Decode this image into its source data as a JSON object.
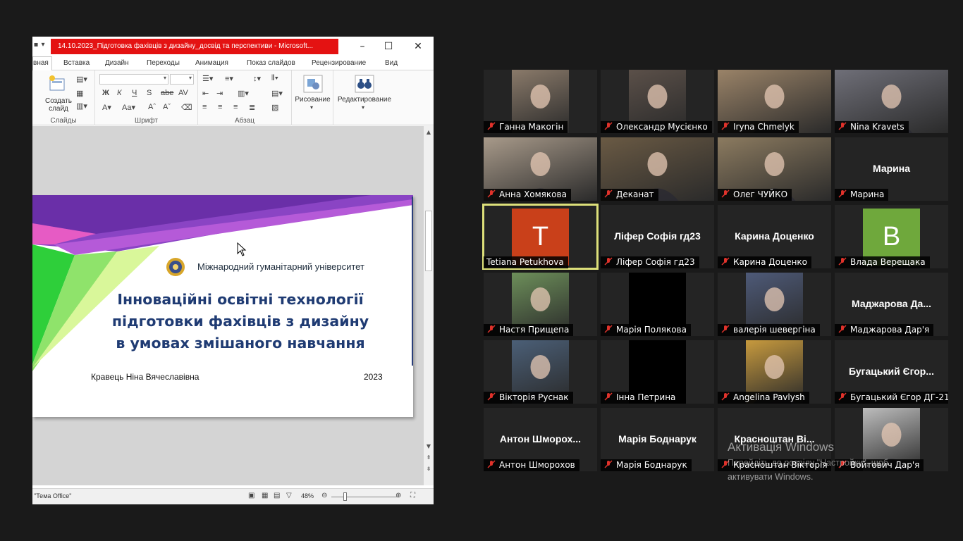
{
  "ppt": {
    "title": "14.10.2023_Підготовка фахівців з дизайну_досвід та перспективи  -  Microsoft...",
    "tabs": [
      "вная",
      "Вставка",
      "Дизайн",
      "Переходы",
      "Анимация",
      "Показ слайдов",
      "Рецензирование",
      "Вид"
    ],
    "ribbon": {
      "create_slide": "Создать слайд",
      "groups": [
        "Слайды",
        "Шрифт",
        "Абзац"
      ],
      "drawing": "Рисование",
      "editing": "Редактирование"
    },
    "slide": {
      "university": "Міжнародний гуманітарний університет",
      "title_lines": [
        "Інноваційні освітні технології",
        "підготовки фахівців з дизайну",
        "в умовах змішаного навчання"
      ],
      "author": "Кравець Ніна Вячеславівна",
      "year": "2023"
    },
    "status": {
      "theme": "\"Тема Office\"",
      "zoom": "48%",
      "zoom_level_percent": 48
    }
  },
  "participants": [
    {
      "name": "Ганна Макогін",
      "video": "photo",
      "muted": true
    },
    {
      "name": "Олександр Мусієнко",
      "video": "photo",
      "muted": true
    },
    {
      "name": "Iryna Chmelyk",
      "video": "photo",
      "muted": true
    },
    {
      "name": "Nina Kravets",
      "video": "photo",
      "muted": true
    },
    {
      "name": "Анна Хомякова",
      "video": "photo",
      "muted": true
    },
    {
      "name": "Деканат",
      "video": "photo",
      "muted": true
    },
    {
      "name": "Олег ЧУЙКО",
      "video": "photo",
      "muted": true
    },
    {
      "name": "Марина",
      "center": "Марина",
      "muted": true
    },
    {
      "name": "Tetiana Petukhova",
      "avatar_letter": "T",
      "avatar_color": "#c9401a",
      "muted": false,
      "active": true
    },
    {
      "name": "Ліфер Софія гд23",
      "center": "Ліфер Софія гд23",
      "muted": true
    },
    {
      "name": "Карина Доценко",
      "center": "Карина Доценко",
      "muted": true
    },
    {
      "name": "Влада Верещака",
      "avatar_letter": "B",
      "avatar_color": "#6fa83c",
      "muted": true
    },
    {
      "name": "Настя Прищепа",
      "video": "photo",
      "muted": true
    },
    {
      "name": "Марія Полякова",
      "video": "black",
      "muted": true
    },
    {
      "name": "валерія шевергіна",
      "video": "photo",
      "muted": true
    },
    {
      "name": "Маджарова Дар'я",
      "center": "Маджарова  Да...",
      "muted": true
    },
    {
      "name": "Вікторія Руснак",
      "video": "photo",
      "muted": true
    },
    {
      "name": "Інна Петрина",
      "video": "black",
      "muted": true
    },
    {
      "name": "Angelina Pavlysh",
      "video": "photo",
      "muted": true
    },
    {
      "name": "Бугацький Єгор ДГ-21",
      "center": "Бугацький Єгор...",
      "muted": true
    },
    {
      "name": "Антон Шморохов",
      "center": "Антон  Шморох...",
      "muted": true
    },
    {
      "name": "Марія Боднарук",
      "center": "Марія Боднарук",
      "muted": true
    },
    {
      "name": "Красноштан Вікторія",
      "center": "Красноштан  Ві...",
      "muted": true
    },
    {
      "name": "Войтович Дар'я",
      "video": "photo",
      "muted": true
    }
  ],
  "watermark": {
    "line1": "Активація Windows",
    "line2": "Перейдіть до розділу \"Настройки\", щоб",
    "line3": "активувати Windows."
  },
  "colors": {
    "title_red": "#e41212",
    "active_speaker": "#dde07a",
    "slide_title": "#1f3b73",
    "mic_muted": "#e0322b"
  }
}
